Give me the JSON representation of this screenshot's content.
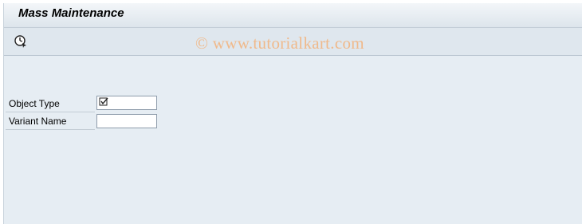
{
  "window": {
    "title": "Mass Maintenance"
  },
  "toolbar": {
    "execute_icon": "execute-icon",
    "watermark": "© www.tutorialkart.com"
  },
  "form": {
    "object_type": {
      "label": "Object Type",
      "value": "",
      "indicator_icon": "checkbox-icon"
    },
    "variant_name": {
      "label": "Variant Name",
      "value": ""
    }
  },
  "colors": {
    "background": "#e6edf3",
    "watermark": "#f0b98a"
  }
}
